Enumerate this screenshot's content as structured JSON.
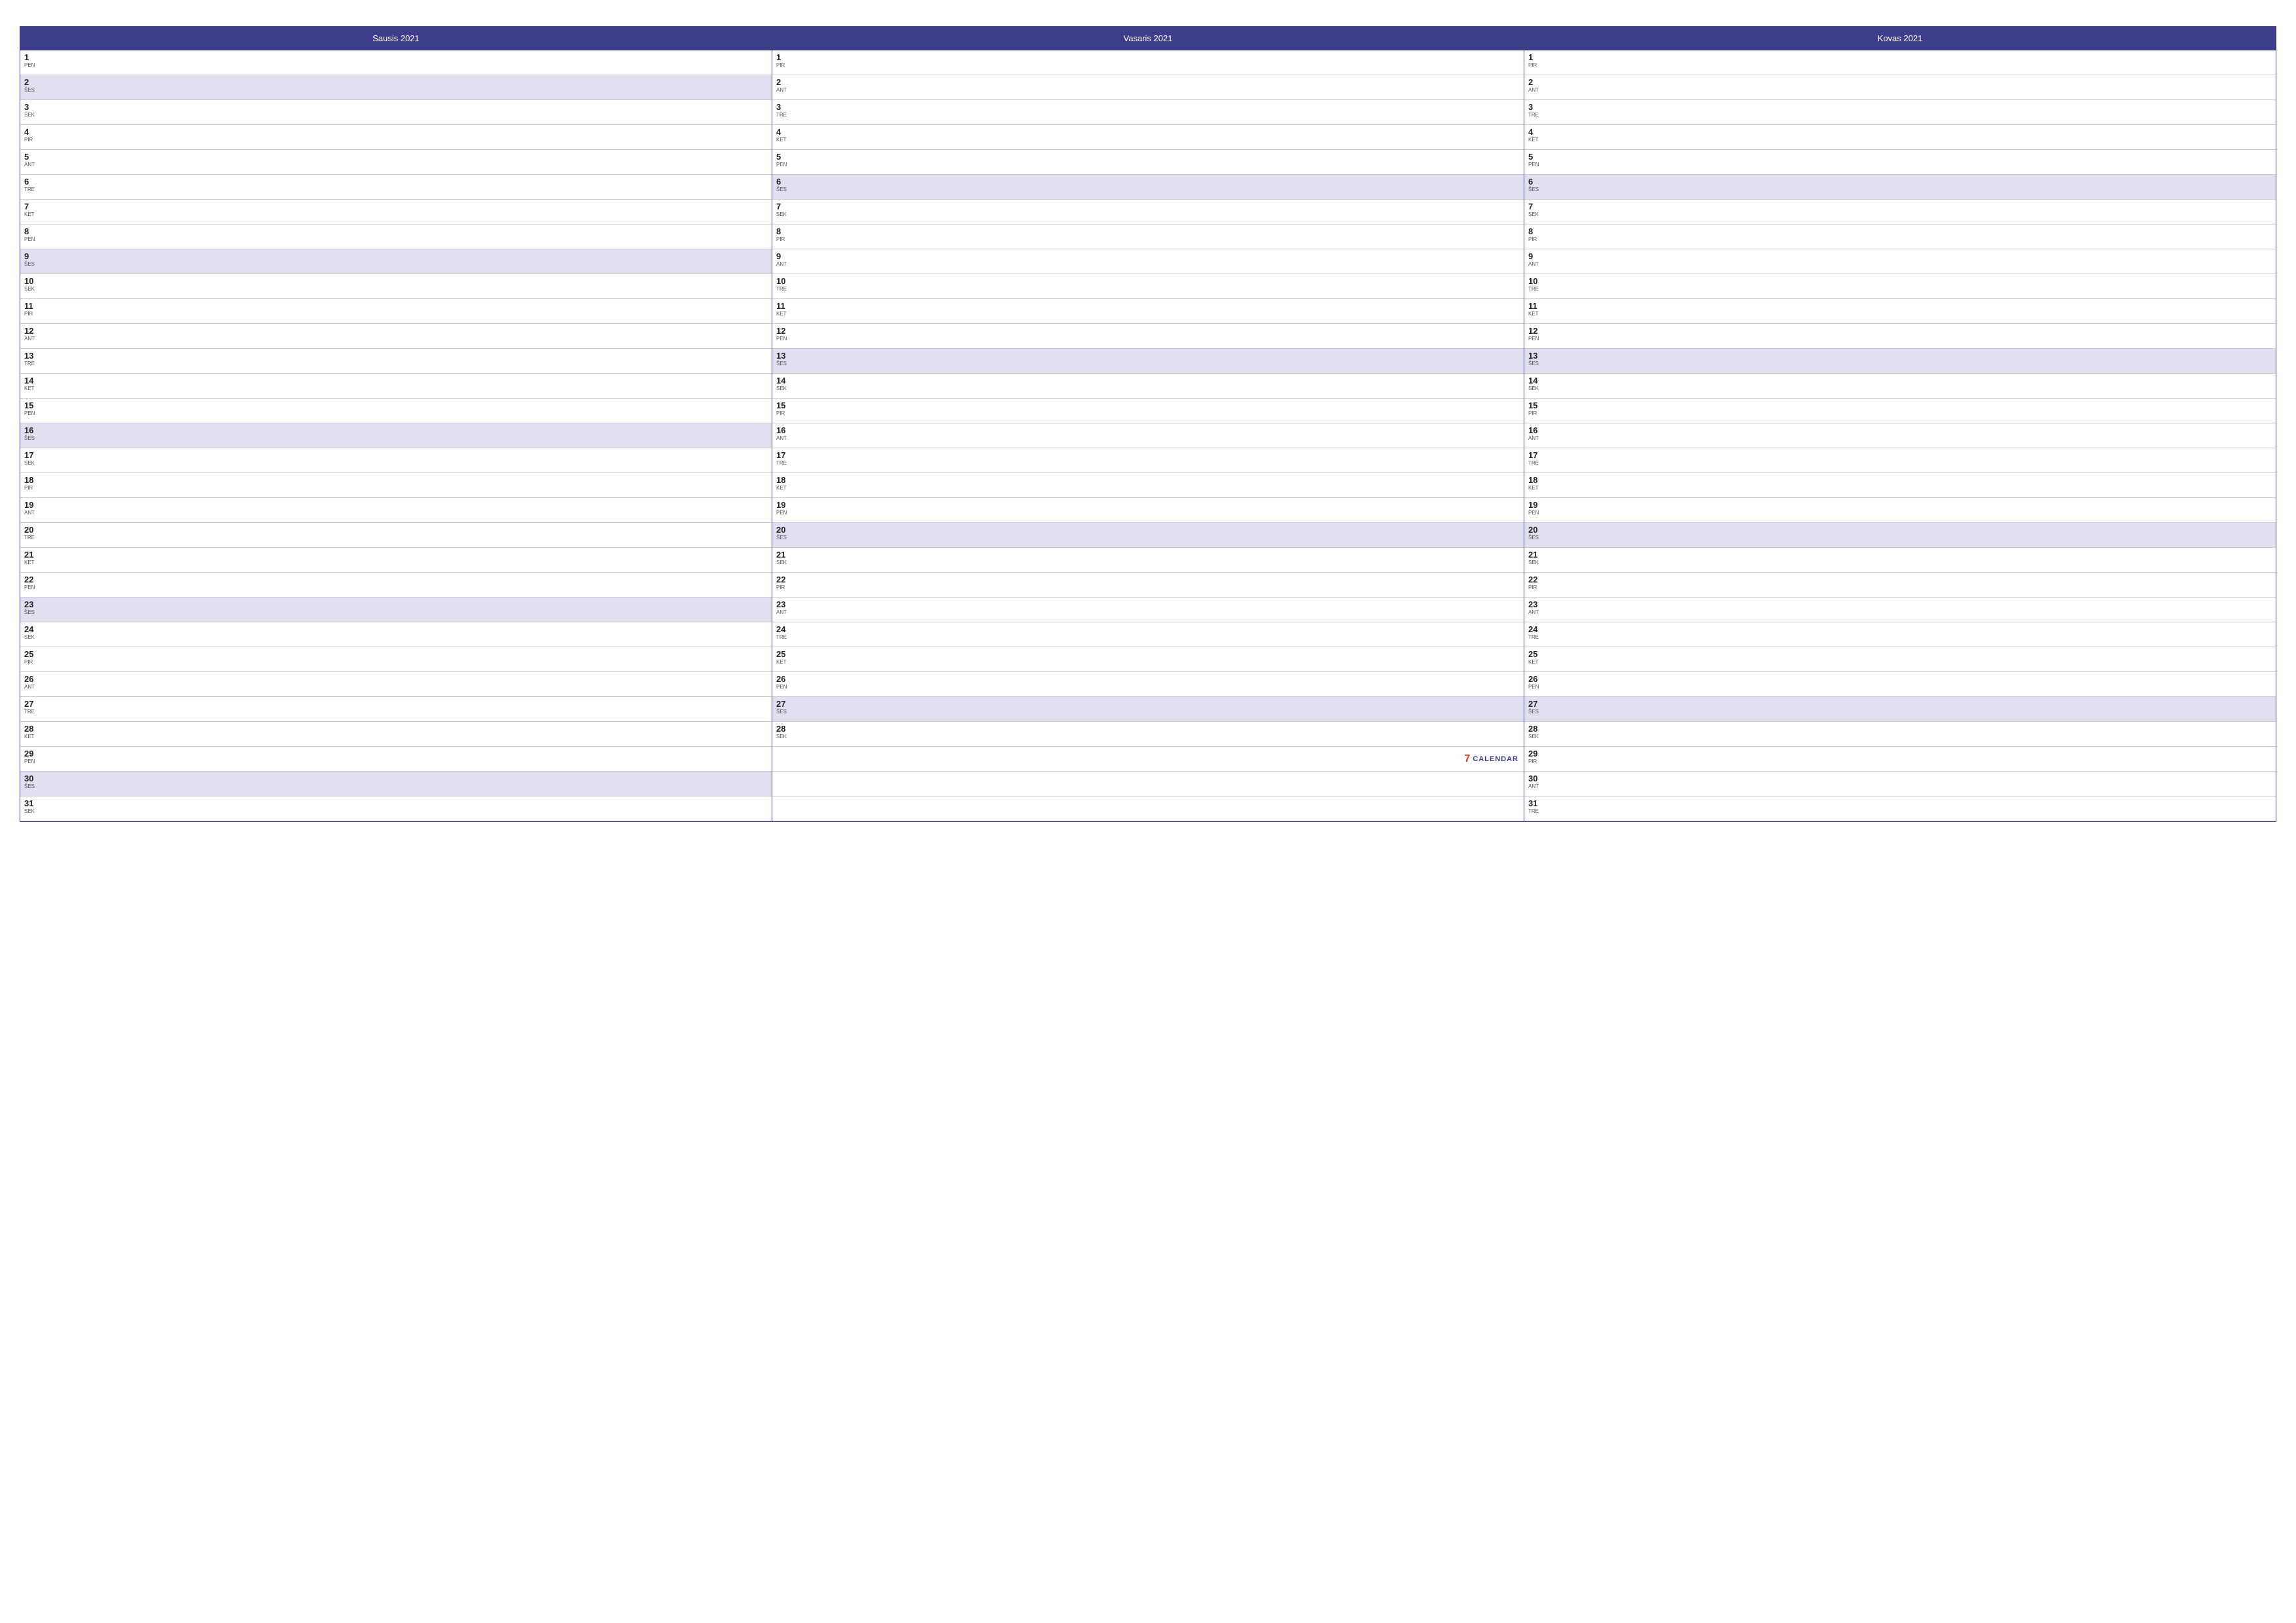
{
  "calendar": {
    "months": [
      {
        "id": "january",
        "header": "Sausis 2021",
        "days": [
          {
            "num": "1",
            "abbr": "PEN",
            "highlight": false
          },
          {
            "num": "2",
            "abbr": "ŠES",
            "highlight": true
          },
          {
            "num": "3",
            "abbr": "SEK",
            "highlight": false
          },
          {
            "num": "4",
            "abbr": "PIR",
            "highlight": false
          },
          {
            "num": "5",
            "abbr": "ANT",
            "highlight": false
          },
          {
            "num": "6",
            "abbr": "TRE",
            "highlight": false
          },
          {
            "num": "7",
            "abbr": "KET",
            "highlight": false
          },
          {
            "num": "8",
            "abbr": "PEN",
            "highlight": false
          },
          {
            "num": "9",
            "abbr": "ŠES",
            "highlight": true
          },
          {
            "num": "10",
            "abbr": "SEK",
            "highlight": false
          },
          {
            "num": "11",
            "abbr": "PIR",
            "highlight": false
          },
          {
            "num": "12",
            "abbr": "ANT",
            "highlight": false
          },
          {
            "num": "13",
            "abbr": "TRE",
            "highlight": false
          },
          {
            "num": "14",
            "abbr": "KET",
            "highlight": false
          },
          {
            "num": "15",
            "abbr": "PEN",
            "highlight": false
          },
          {
            "num": "16",
            "abbr": "ŠES",
            "highlight": true
          },
          {
            "num": "17",
            "abbr": "SEK",
            "highlight": false
          },
          {
            "num": "18",
            "abbr": "PIR",
            "highlight": false
          },
          {
            "num": "19",
            "abbr": "ANT",
            "highlight": false
          },
          {
            "num": "20",
            "abbr": "TRE",
            "highlight": false
          },
          {
            "num": "21",
            "abbr": "KET",
            "highlight": false
          },
          {
            "num": "22",
            "abbr": "PEN",
            "highlight": false
          },
          {
            "num": "23",
            "abbr": "ŠES",
            "highlight": true
          },
          {
            "num": "24",
            "abbr": "SEK",
            "highlight": false
          },
          {
            "num": "25",
            "abbr": "PIR",
            "highlight": false
          },
          {
            "num": "26",
            "abbr": "ANT",
            "highlight": false
          },
          {
            "num": "27",
            "abbr": "TRE",
            "highlight": false
          },
          {
            "num": "28",
            "abbr": "KET",
            "highlight": false
          },
          {
            "num": "29",
            "abbr": "PEN",
            "highlight": false
          },
          {
            "num": "30",
            "abbr": "ŠES",
            "highlight": true
          },
          {
            "num": "31",
            "abbr": "SEK",
            "highlight": false
          }
        ]
      },
      {
        "id": "february",
        "header": "Vasaris 2021",
        "days": [
          {
            "num": "1",
            "abbr": "PIR",
            "highlight": false
          },
          {
            "num": "2",
            "abbr": "ANT",
            "highlight": false
          },
          {
            "num": "3",
            "abbr": "TRE",
            "highlight": false
          },
          {
            "num": "4",
            "abbr": "KET",
            "highlight": false
          },
          {
            "num": "5",
            "abbr": "PEN",
            "highlight": false
          },
          {
            "num": "6",
            "abbr": "ŠES",
            "highlight": true
          },
          {
            "num": "7",
            "abbr": "SEK",
            "highlight": false
          },
          {
            "num": "8",
            "abbr": "PIR",
            "highlight": false
          },
          {
            "num": "9",
            "abbr": "ANT",
            "highlight": false
          },
          {
            "num": "10",
            "abbr": "TRE",
            "highlight": false
          },
          {
            "num": "11",
            "abbr": "KET",
            "highlight": false
          },
          {
            "num": "12",
            "abbr": "PEN",
            "highlight": false
          },
          {
            "num": "13",
            "abbr": "ŠES",
            "highlight": true
          },
          {
            "num": "14",
            "abbr": "SEK",
            "highlight": false
          },
          {
            "num": "15",
            "abbr": "PIR",
            "highlight": false
          },
          {
            "num": "16",
            "abbr": "ANT",
            "highlight": false
          },
          {
            "num": "17",
            "abbr": "TRE",
            "highlight": false
          },
          {
            "num": "18",
            "abbr": "KET",
            "highlight": false
          },
          {
            "num": "19",
            "abbr": "PEN",
            "highlight": false
          },
          {
            "num": "20",
            "abbr": "ŠES",
            "highlight": true
          },
          {
            "num": "21",
            "abbr": "SEK",
            "highlight": false
          },
          {
            "num": "22",
            "abbr": "PIR",
            "highlight": false
          },
          {
            "num": "23",
            "abbr": "ANT",
            "highlight": false
          },
          {
            "num": "24",
            "abbr": "TRE",
            "highlight": false
          },
          {
            "num": "25",
            "abbr": "KET",
            "highlight": false
          },
          {
            "num": "26",
            "abbr": "PEN",
            "highlight": false
          },
          {
            "num": "27",
            "abbr": "ŠES",
            "highlight": true
          },
          {
            "num": "28",
            "abbr": "SEK",
            "highlight": false
          }
        ],
        "watermark": true,
        "watermark_icon": "7",
        "watermark_label": "CALENDAR"
      },
      {
        "id": "march",
        "header": "Kovas 2021",
        "days": [
          {
            "num": "1",
            "abbr": "PIR",
            "highlight": false
          },
          {
            "num": "2",
            "abbr": "ANT",
            "highlight": false
          },
          {
            "num": "3",
            "abbr": "TRE",
            "highlight": false
          },
          {
            "num": "4",
            "abbr": "KET",
            "highlight": false
          },
          {
            "num": "5",
            "abbr": "PEN",
            "highlight": false
          },
          {
            "num": "6",
            "abbr": "ŠES",
            "highlight": true
          },
          {
            "num": "7",
            "abbr": "SEK",
            "highlight": false
          },
          {
            "num": "8",
            "abbr": "PIR",
            "highlight": false
          },
          {
            "num": "9",
            "abbr": "ANT",
            "highlight": false
          },
          {
            "num": "10",
            "abbr": "TRE",
            "highlight": false
          },
          {
            "num": "11",
            "abbr": "KET",
            "highlight": false
          },
          {
            "num": "12",
            "abbr": "PEN",
            "highlight": false
          },
          {
            "num": "13",
            "abbr": "ŠES",
            "highlight": true
          },
          {
            "num": "14",
            "abbr": "SEK",
            "highlight": false
          },
          {
            "num": "15",
            "abbr": "PIR",
            "highlight": false
          },
          {
            "num": "16",
            "abbr": "ANT",
            "highlight": false
          },
          {
            "num": "17",
            "abbr": "TRE",
            "highlight": false
          },
          {
            "num": "18",
            "abbr": "KET",
            "highlight": false
          },
          {
            "num": "19",
            "abbr": "PEN",
            "highlight": false
          },
          {
            "num": "20",
            "abbr": "ŠES",
            "highlight": true
          },
          {
            "num": "21",
            "abbr": "SEK",
            "highlight": false
          },
          {
            "num": "22",
            "abbr": "PIR",
            "highlight": false
          },
          {
            "num": "23",
            "abbr": "ANT",
            "highlight": false
          },
          {
            "num": "24",
            "abbr": "TRE",
            "highlight": false
          },
          {
            "num": "25",
            "abbr": "KET",
            "highlight": false
          },
          {
            "num": "26",
            "abbr": "PEN",
            "highlight": false
          },
          {
            "num": "27",
            "abbr": "ŠES",
            "highlight": true
          },
          {
            "num": "28",
            "abbr": "SEK",
            "highlight": false
          },
          {
            "num": "29",
            "abbr": "PIR",
            "highlight": false
          },
          {
            "num": "30",
            "abbr": "ANT",
            "highlight": false
          },
          {
            "num": "31",
            "abbr": "TRE",
            "highlight": false
          }
        ]
      }
    ]
  }
}
